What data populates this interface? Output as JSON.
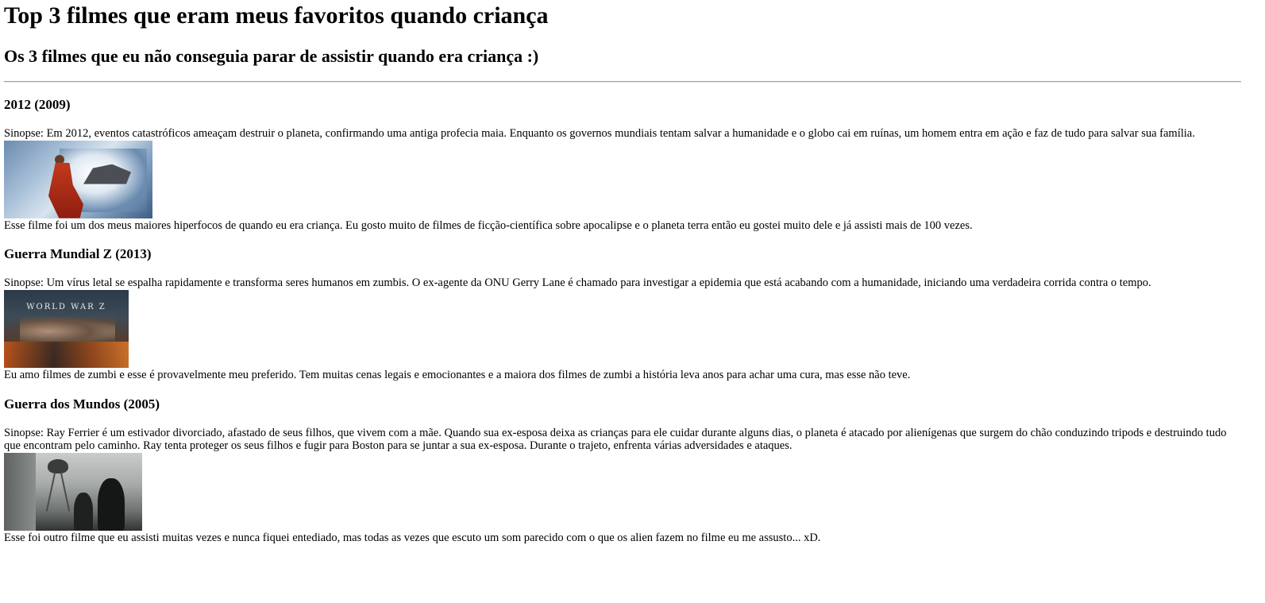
{
  "page": {
    "title": "Top 3 filmes que eram meus favoritos quando criança",
    "subtitle": "Os 3 filmes que eu não conseguia parar de assistir quando era criança :)"
  },
  "movies": [
    {
      "heading": "2012 (2009)",
      "synopsis": "Sinopse: Em 2012, eventos catastróficos ameaçam destruir o planeta, confirmando uma antiga profecia maia. Enquanto os governos mundiais tentam salvar a humanidade e o globo cai em ruínas, um homem entra em ação e faz de tudo para salvar sua família.",
      "comment": "Esse filme foi um dos meus maiores hiperfocos de quando eu era criança. Eu gosto muito de filmes de ficção-científica sobre apocalipse e o planeta terra então eu gostei muito dele e já assisti mais de 100 vezes."
    },
    {
      "heading": "Guerra Mundial Z (2013)",
      "synopsis": "Sinopse: Um vírus letal se espalha rapidamente e transforma seres humanos em zumbis. O ex-agente da ONU Gerry Lane é chamado para investigar a epidemia que está acabando com a humanidade, iniciando uma verdadeira corrida contra o tempo.",
      "poster_text": "WORLD WAR Z",
      "comment": "Eu amo filmes de zumbi e esse é provavelmente meu preferido. Tem muitas cenas legais e emocionantes e a maiora dos filmes de zumbi a história leva anos para achar uma cura, mas esse não teve."
    },
    {
      "heading": "Guerra dos Mundos (2005)",
      "synopsis": "Sinopse: Ray Ferrier é um estivador divorciado, afastado de seus filhos, que vivem com a mãe. Quando sua ex-esposa deixa as crianças para ele cuidar durante alguns dias, o planeta é atacado por alienígenas que surgem do chão conduzindo tripods e destruindo tudo que encontram pelo caminho. Ray tenta proteger os seus filhos e fugir para Boston para se juntar a sua ex-esposa. Durante o trajeto, enfrenta várias adversidades e ataques.",
      "comment": "Esse foi outro filme que eu assisti muitas vezes e nunca fiquei entediado, mas todas as vezes que escuto um som parecido com o que os alien fazem no filme eu me assusto... xD."
    }
  ]
}
